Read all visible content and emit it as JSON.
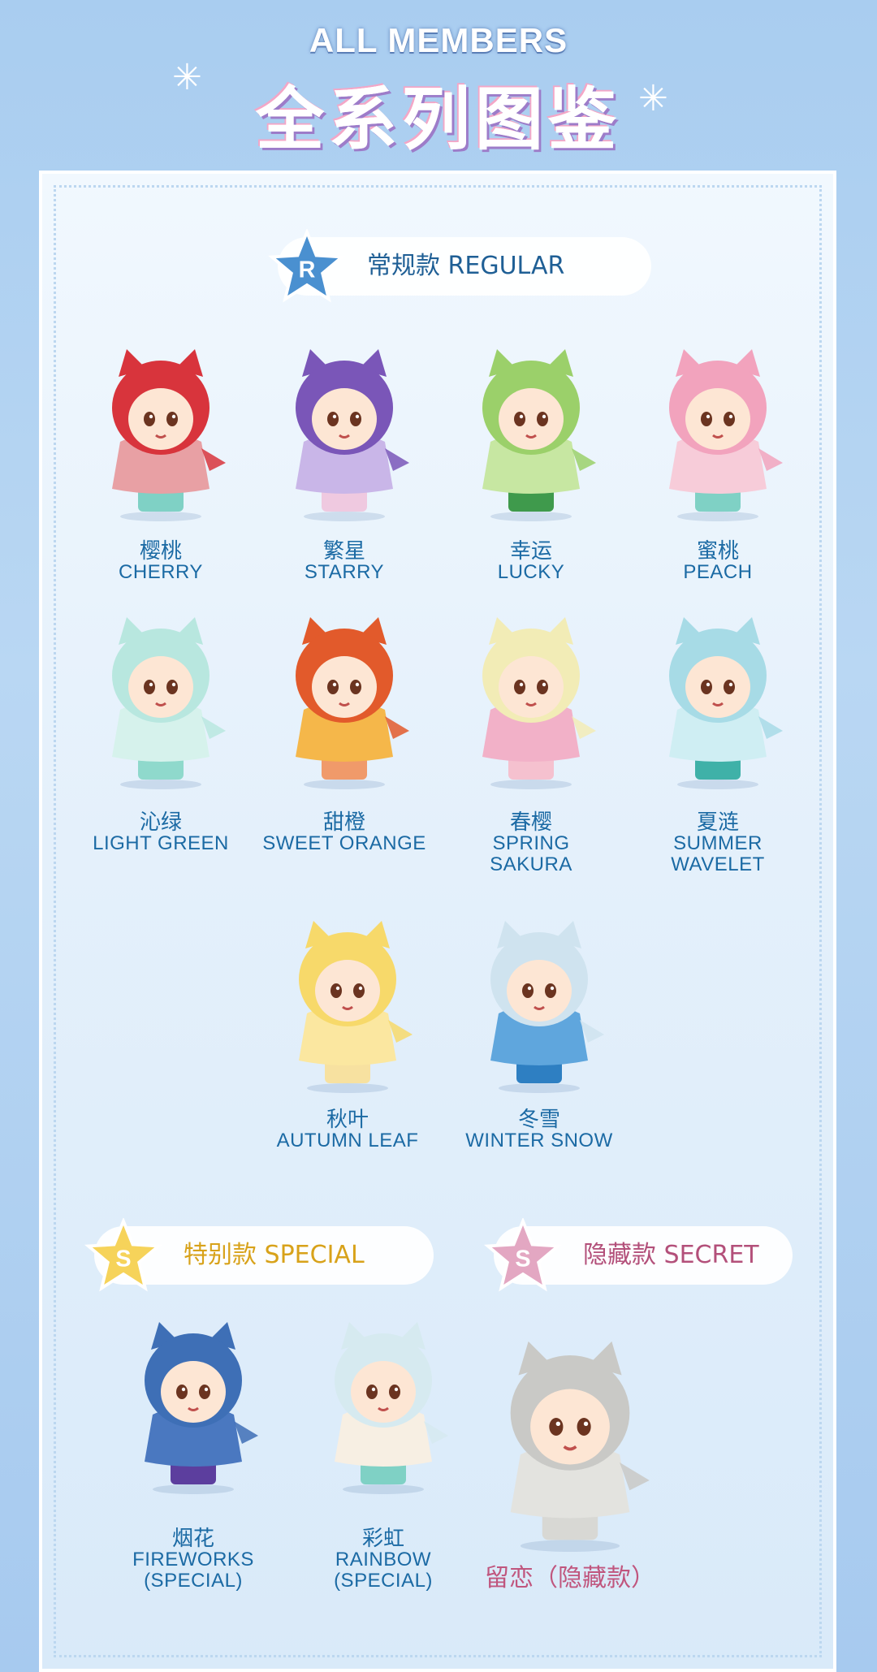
{
  "header": {
    "title_en": "ALL MEMBERS",
    "title_cn": "全系列图鉴"
  },
  "sections": {
    "regular": {
      "badge": "R",
      "label": "常规款 REGULAR",
      "color": "#3f86c6"
    },
    "special": {
      "badge": "S",
      "label": "特别款 SPECIAL",
      "color": "#f1c94a"
    },
    "secret": {
      "badge": "S",
      "label": "隐藏款 SECRET",
      "color": "#d98fb0"
    }
  },
  "regular_members": [
    {
      "cn": "樱桃",
      "en": [
        "CHERRY"
      ],
      "hood": "#d8343c",
      "body": "#e8a0a4",
      "boots": "#7fd1c5"
    },
    {
      "cn": "繁星",
      "en": [
        "STARRY"
      ],
      "hood": "#7a56b8",
      "body": "#c9b6e8",
      "boots": "#efc9e0"
    },
    {
      "cn": "幸运",
      "en": [
        "LUCKY"
      ],
      "hood": "#9bd06a",
      "body": "#c7e7a2",
      "boots": "#3f9a4c"
    },
    {
      "cn": "蜜桃",
      "en": [
        "PEACH"
      ],
      "hood": "#f2a3bd",
      "body": "#f7ccd9",
      "boots": "#7fd1c5"
    },
    {
      "cn": "沁绿",
      "en": [
        "LIGHT GREEN"
      ],
      "hood": "#b8e7df",
      "body": "#d6f2ec",
      "boots": "#8fd9cc"
    },
    {
      "cn": "甜橙",
      "en": [
        "SWEET ORANGE"
      ],
      "hood": "#e25a2b",
      "body": "#f5b74a",
      "boots": "#f09a6a"
    },
    {
      "cn": "春樱",
      "en": [
        "SPRING",
        "SAKURA"
      ],
      "hood": "#f2ecb6",
      "body": "#f2b1c8",
      "boots": "#f5c1cf"
    },
    {
      "cn": "夏涟",
      "en": [
        "SUMMER",
        "WAVELET"
      ],
      "hood": "#a7dbe6",
      "body": "#cfeef3",
      "boots": "#3fb1a8"
    },
    {
      "cn": "秋叶",
      "en": [
        "AUTUMN LEAF"
      ],
      "hood": "#f7d96a",
      "body": "#fbe7a0",
      "boots": "#f7e1a0"
    },
    {
      "cn": "冬雪",
      "en": [
        "WINTER SNOW"
      ],
      "hood": "#cfe3ef",
      "body": "#5fa6dd",
      "boots": "#2e7fc2"
    }
  ],
  "special_members": [
    {
      "cn": "烟花",
      "en": [
        "FIREWORKS",
        "(SPECIAL)"
      ],
      "hood": "#3e6fb6",
      "body": "#4a78c0",
      "boots": "#5c3e9e"
    },
    {
      "cn": "彩虹",
      "en": [
        "RAINBOW",
        "(SPECIAL)"
      ],
      "hood": "#d6eaf0",
      "body": "#f7efe3",
      "boots": "#7fd1c5"
    }
  ],
  "secret_member": {
    "label": "留恋（隐藏款）",
    "hood": "#c9c9c6",
    "body": "#e3e3df",
    "boots": "#d8d8d4"
  }
}
